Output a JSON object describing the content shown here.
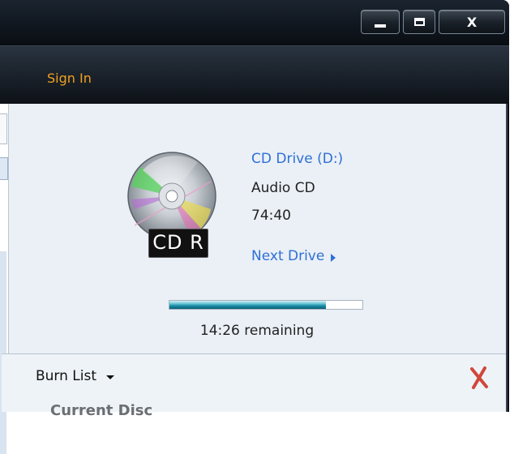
{
  "window": {
    "minimize_icon": "minimize-icon",
    "maximize_icon": "maximize-icon",
    "close_label": "X"
  },
  "header": {
    "signin_label": "Sign In",
    "signin_color": "#f0a020"
  },
  "drive": {
    "name": "CD Drive (D:)",
    "disc_type": "Audio CD",
    "total_time": "74:40",
    "next_drive_label": "Next Drive",
    "media_badge": "CD R",
    "link_color": "#2f6fd6"
  },
  "progress": {
    "fraction": 0.81,
    "remaining_text": "14:26 remaining"
  },
  "burn": {
    "list_label": "Burn List",
    "clear_icon": "clear-list-icon",
    "clear_color": "#d0473b",
    "current_disc_label": "Current Disc"
  }
}
